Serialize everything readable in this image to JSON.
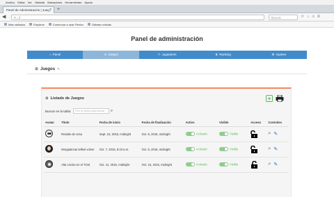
{
  "browser": {
    "menu": [
      "Archivo",
      "Editar",
      "Ver",
      "Historial",
      "Marcadores",
      "Herramientas",
      "Ayuda"
    ],
    "tab_title": "Panel de Administración | Jueg...",
    "url": "< .../",
    "search_placeholder": "Buscar",
    "bookmarks": [
      "Más visitados",
      "Empiece",
      "Comenzar a usar Firefox",
      "Últimas noticias"
    ]
  },
  "page": {
    "title": "Panel de administración",
    "nav": [
      {
        "icon": "home-icon",
        "glyph": "⌂",
        "label": "Panel",
        "active": false
      },
      {
        "icon": "gamepad-icon",
        "glyph": "⊙",
        "label": "Juegos",
        "active": true
      },
      {
        "icon": "users-icon",
        "glyph": "⚇",
        "label": "Jugadores",
        "active": false
      },
      {
        "icon": "trophy-icon",
        "glyph": "♛",
        "label": "Ranking",
        "active": false
      },
      {
        "icon": "gear-icon",
        "glyph": "⚙",
        "label": "Ajustes",
        "active": false
      }
    ],
    "section_title": "Juegos",
    "section_edit_glyph": "✎"
  },
  "panel": {
    "title": "Listado de Juegos",
    "add_glyph": "+",
    "search_label": "Buscar en la tabla:",
    "search_placeholder": "Pon un texto para buscar",
    "search_glyph": "⌕",
    "columns": [
      "Avatar",
      "Título",
      "Fecha de inicio",
      "Fecha de finalización",
      "Activo",
      "Visible",
      "Acceso",
      "Controles"
    ],
    "rows": [
      {
        "title": "Rosalie de cesa",
        "start": "Sept. 24, 2015, midnight",
        "end": "Oct. 6, 2015, midnight",
        "active": "Activado",
        "visible": "Visible"
      },
      {
        "title": "Morgadecas tellset volver",
        "start": "Oct. 7, 2015, 8:43 a.m.",
        "end": "Oct. 6, 2015, midnight",
        "active": "Activado",
        "visible": "Visible"
      },
      {
        "title": "Alta cocina en el TCM",
        "start": "Oct. 12, 2015, midnight",
        "end": "Oct. 15, 2015, midnight",
        "active": "Activado",
        "visible": "Visible"
      }
    ]
  },
  "colors": {
    "nav": "#428bca",
    "nav_active": "#8eb6da",
    "accent": "#f08a5d",
    "success": "#5cb85c",
    "link": "#2a6ebb"
  }
}
